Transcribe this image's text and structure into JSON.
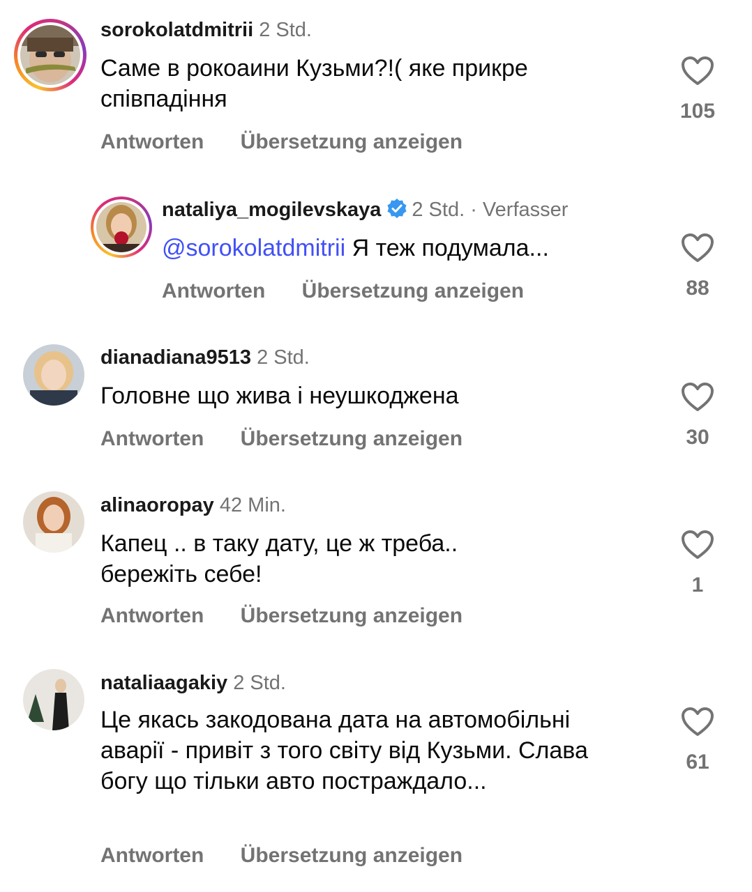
{
  "comments": [
    {
      "username": "sorokolatdmitrii",
      "time": "2 Std.",
      "text": "Саме в рокоаини Кузьми?!( яке прикре співпадіння",
      "reply_label": "Antworten",
      "translate_label": "Übersetzung anzeigen",
      "likes": "105",
      "story_ring": true
    },
    {
      "username": "nataliya_mogilevskaya",
      "verified": true,
      "time": "2 Std.",
      "author_tag": "· Verfasser",
      "mention": "@sorokolatdmitrii",
      "text": " Я теж подумала...",
      "reply_label": "Antworten",
      "translate_label": "Übersetzung anzeigen",
      "likes": "88",
      "story_ring": true
    },
    {
      "username": "dianadiana9513",
      "time": "2 Std.",
      "text": "Головне що жива і неушкоджена",
      "reply_label": "Antworten",
      "translate_label": "Übersetzung anzeigen",
      "likes": "30"
    },
    {
      "username": "alinaoropay",
      "time": "42 Min.",
      "text": "Капец .. в таку дату, це ж треба.. бережіть себе!",
      "reply_label": "Antworten",
      "translate_label": "Übersetzung anzeigen",
      "likes": "1"
    },
    {
      "username": "nataliaagakiy",
      "time": "2 Std.",
      "text": "Це якась закодована дата на автомобільні аварії - привіт з того світу від Кузьми. Слава богу що тільки авто постраждало...",
      "reply_label": "Antworten",
      "translate_label": "Übersetzung anzeigen",
      "likes": "61"
    }
  ],
  "colors": {
    "verified_blue": "#3897f0",
    "mention_blue": "#4150f7",
    "meta_gray": "#737373"
  },
  "icons": {
    "like": "heart-outline-icon",
    "verified": "verified-badge-icon"
  }
}
